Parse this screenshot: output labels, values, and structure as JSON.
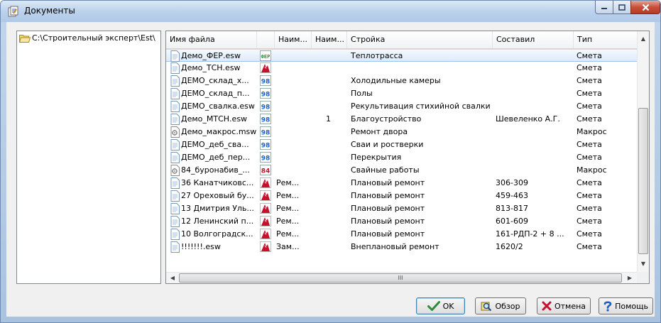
{
  "window": {
    "title": "Документы",
    "title_icon": "documents-icon",
    "controls": [
      "minimize-icon",
      "maximize-icon",
      "close-icon"
    ]
  },
  "tree": {
    "root_label": "C:\\Строительный эксперт\\Est\\",
    "icon": "folder-open-icon"
  },
  "list": {
    "columns": [
      "Имя файла",
      "",
      "Наим...",
      "Наим...",
      "Стройка",
      "Составил",
      "Тип"
    ],
    "selected_row": 0,
    "rows": [
      {
        "name": "Демо_ФЕР.esw",
        "file_icon": "document-icon",
        "type_icon": "fer-icon",
        "naim1": "",
        "naim2": "",
        "stroyka": "Теплотрасса",
        "sostavil": "",
        "tip": "Смета"
      },
      {
        "name": "Демо_ТСН.esw",
        "file_icon": "document-icon",
        "type_icon": "estimate-red-icon",
        "naim1": "",
        "naim2": "",
        "stroyka": "",
        "sostavil": "",
        "tip": "Смета"
      },
      {
        "name": "ДЕМО_склад_х...",
        "file_icon": "document-icon",
        "type_icon": "98-icon",
        "naim1": "",
        "naim2": "",
        "stroyka": "Холодильные камеры",
        "sostavil": "",
        "tip": "Смета"
      },
      {
        "name": "ДЕМО_склад_п...",
        "file_icon": "document-icon",
        "type_icon": "98-icon",
        "naim1": "",
        "naim2": "",
        "stroyka": "Полы",
        "sostavil": "",
        "tip": "Смета"
      },
      {
        "name": "ДЕМО_свалка.esw",
        "file_icon": "document-icon",
        "type_icon": "98-icon",
        "naim1": "",
        "naim2": "",
        "stroyka": "Рекультивация стихийной свалки",
        "sostavil": "",
        "tip": "Смета"
      },
      {
        "name": "Демо_МТСН.esw",
        "file_icon": "document-icon",
        "type_icon": "98-icon",
        "naim1": "",
        "naim2": "1",
        "stroyka": "Благоустройство",
        "sostavil": "Шевеленко А.Г.",
        "tip": "Смета"
      },
      {
        "name": "Демо_макрос.msw",
        "file_icon": "macro-icon",
        "type_icon": "98-icon",
        "naim1": "",
        "naim2": "",
        "stroyka": "Ремонт двора",
        "sostavil": "",
        "tip": "Макрос"
      },
      {
        "name": "ДЕМО_деб_сва...",
        "file_icon": "document-icon",
        "type_icon": "98-icon",
        "naim1": "",
        "naim2": "",
        "stroyka": "Сваи и ростверки",
        "sostavil": "",
        "tip": "Смета"
      },
      {
        "name": "ДЕМО_деб_пер...",
        "file_icon": "document-icon",
        "type_icon": "98-icon",
        "naim1": "",
        "naim2": "",
        "stroyka": "Перекрытия",
        "sostavil": "",
        "tip": "Смета"
      },
      {
        "name": "84_буронабив_...",
        "file_icon": "macro-icon",
        "type_icon": "84-icon",
        "naim1": "",
        "naim2": "",
        "stroyka": "Свайные работы",
        "sostavil": "",
        "tip": "Макрос"
      },
      {
        "name": "36 Канатчиковс...",
        "file_icon": "document-icon",
        "type_icon": "estimate-red-icon",
        "naim1": "Рем...",
        "naim2": "",
        "stroyka": "Плановый ремонт",
        "sostavil": "306-309",
        "tip": "Смета"
      },
      {
        "name": "27 Ореховый бу...",
        "file_icon": "document-icon",
        "type_icon": "estimate-red-icon",
        "naim1": "Рем...",
        "naim2": "",
        "stroyka": "Плановый ремонт",
        "sostavil": "459-463",
        "tip": "Смета"
      },
      {
        "name": "13 Дмитрия Уль...",
        "file_icon": "document-icon",
        "type_icon": "estimate-red-icon",
        "naim1": "Рем...",
        "naim2": "",
        "stroyka": "Плановый ремонт",
        "sostavil": "813-817",
        "tip": "Смета"
      },
      {
        "name": "12 Ленинский п...",
        "file_icon": "document-icon",
        "type_icon": "estimate-red-icon",
        "naim1": "Рем...",
        "naim2": "",
        "stroyka": "Плановый ремонт",
        "sostavil": "601-609",
        "tip": "Смета"
      },
      {
        "name": "10 Волгоградск...",
        "file_icon": "document-icon",
        "type_icon": "estimate-red-icon",
        "naim1": "Рем...",
        "naim2": "",
        "stroyka": "Плановый ремонт",
        "sostavil": "161-РДП-2 + 8 ...",
        "tip": "Смета"
      },
      {
        "name": "!!!!!!!.esw",
        "file_icon": "document-icon",
        "type_icon": "estimate-red-icon",
        "naim1": "Зам...",
        "naim2": "",
        "stroyka": "Внеплановый ремонт",
        "sostavil": "1620/2",
        "tip": "Смета"
      }
    ]
  },
  "scrollbars": {
    "horizontal_thumb_grip": "III"
  },
  "buttons": {
    "ok": "OK",
    "browse": "Обзор",
    "cancel": "Отмена",
    "help": "Помощь"
  },
  "colors": {
    "selection": "#dcebfb",
    "accent_red": "#c8102e",
    "accent_blue": "#1e5fbf",
    "fer_green": "#2e8b3a"
  }
}
